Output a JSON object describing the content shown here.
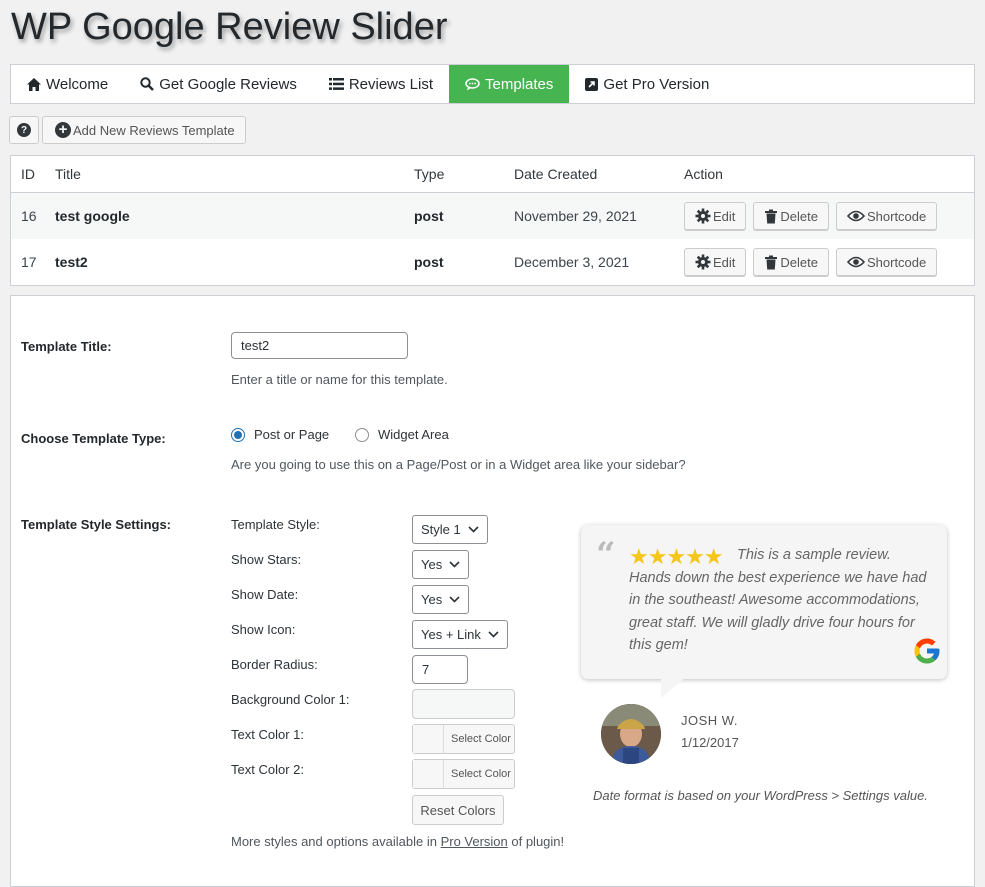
{
  "page_title": "WP Google Review Slider",
  "tabs": [
    {
      "label": "Welcome",
      "icon": "home-icon",
      "active": false
    },
    {
      "label": "Get Google Reviews",
      "icon": "search-icon",
      "active": false
    },
    {
      "label": "Reviews List",
      "icon": "list-icon",
      "active": false
    },
    {
      "label": "Templates",
      "icon": "comments-icon",
      "active": true
    },
    {
      "label": "Get Pro Version",
      "icon": "external-link-icon",
      "active": false
    }
  ],
  "toolbar": {
    "help_label": "?",
    "add_label": "Add New Reviews Template"
  },
  "table": {
    "headers": {
      "id": "ID",
      "title": "Title",
      "type": "Type",
      "date": "Date Created",
      "action": "Action"
    },
    "rows": [
      {
        "id": "16",
        "title": "test google",
        "type": "post",
        "date": "November 29, 2021"
      },
      {
        "id": "17",
        "title": "test2",
        "type": "post",
        "date": "December 3, 2021"
      }
    ],
    "actions": {
      "edit": "Edit",
      "delete": "Delete",
      "shortcode": "Shortcode"
    }
  },
  "form": {
    "title_label": "Template Title:",
    "title_value": "test2",
    "title_desc": "Enter a title or name for this template.",
    "type_label": "Choose Template Type:",
    "type_options": [
      "Post or Page",
      "Widget Area"
    ],
    "type_selected": "Post or Page",
    "type_desc": "Are you going to use this on a Page/Post or in a Widget area like your sidebar?",
    "style_label": "Template Style Settings:",
    "settings": {
      "template_style": {
        "label": "Template Style:",
        "value": "Style 1"
      },
      "show_stars": {
        "label": "Show Stars:",
        "value": "Yes"
      },
      "show_date": {
        "label": "Show Date:",
        "value": "Yes"
      },
      "show_icon": {
        "label": "Show Icon:",
        "value": "Yes + Link"
      },
      "border_radius": {
        "label": "Border Radius:",
        "value": "7"
      },
      "bg_color_1": {
        "label": "Background Color 1:",
        "value": ""
      },
      "text_color_1": {
        "label": "Text Color 1:",
        "button": "Select Color"
      },
      "text_color_2": {
        "label": "Text Color 2:",
        "button": "Select Color"
      }
    },
    "reset_label": "Reset Colors",
    "more_prefix": "More styles and options available in ",
    "more_link": "Pro Version",
    "more_suffix": " of plugin!"
  },
  "preview": {
    "stars": "★★★★★",
    "rating": 5,
    "text": "This is a sample review. Hands down the best experience we have had in the southeast! Awesome accommodations, great staff. We will gladly drive four hours for this gem!",
    "name": "JOSH W.",
    "date": "1/12/2017",
    "date_note": "Date format is based on your WordPress > Settings value."
  },
  "colors": {
    "active_tab": "#46b450",
    "star": "#f5c518",
    "radio": "#2271b1"
  }
}
